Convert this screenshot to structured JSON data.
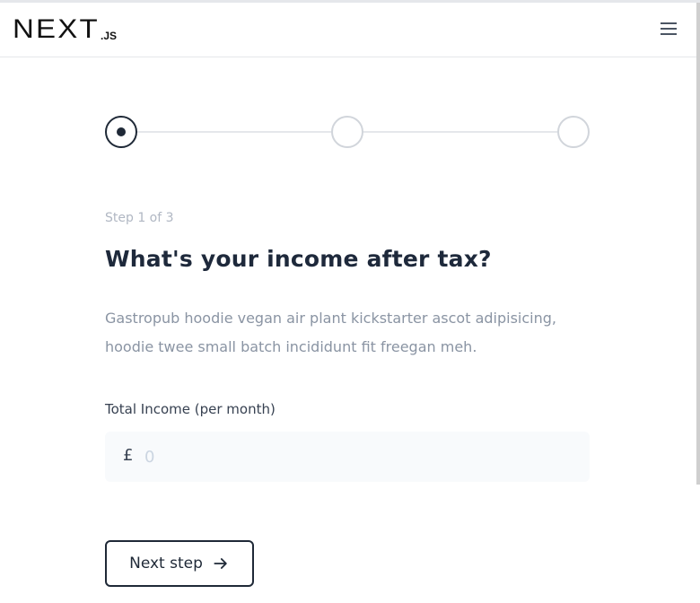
{
  "header": {
    "logo_main": "NEXT",
    "logo_sub": ".JS",
    "menu_icon": "hamburger-menu-icon"
  },
  "stepper": {
    "current_step": 1,
    "total_steps": 3,
    "label": "Step 1 of 3"
  },
  "content": {
    "title": "What's your income after tax?",
    "description": "Gastropub hoodie vegan air plant kickstarter ascot adipisicing, hoodie twee small batch incididunt fit freegan meh."
  },
  "form": {
    "field_label": "Total Income (per month)",
    "currency_symbol": "£",
    "input_value": "",
    "input_placeholder": "0"
  },
  "actions": {
    "next_label": "Next step",
    "next_icon": "arrow-right-icon"
  },
  "colors": {
    "primary": "#1f2937",
    "muted": "#8a94a3",
    "border": "#e5e7eb",
    "input_bg": "#f8fafc"
  }
}
